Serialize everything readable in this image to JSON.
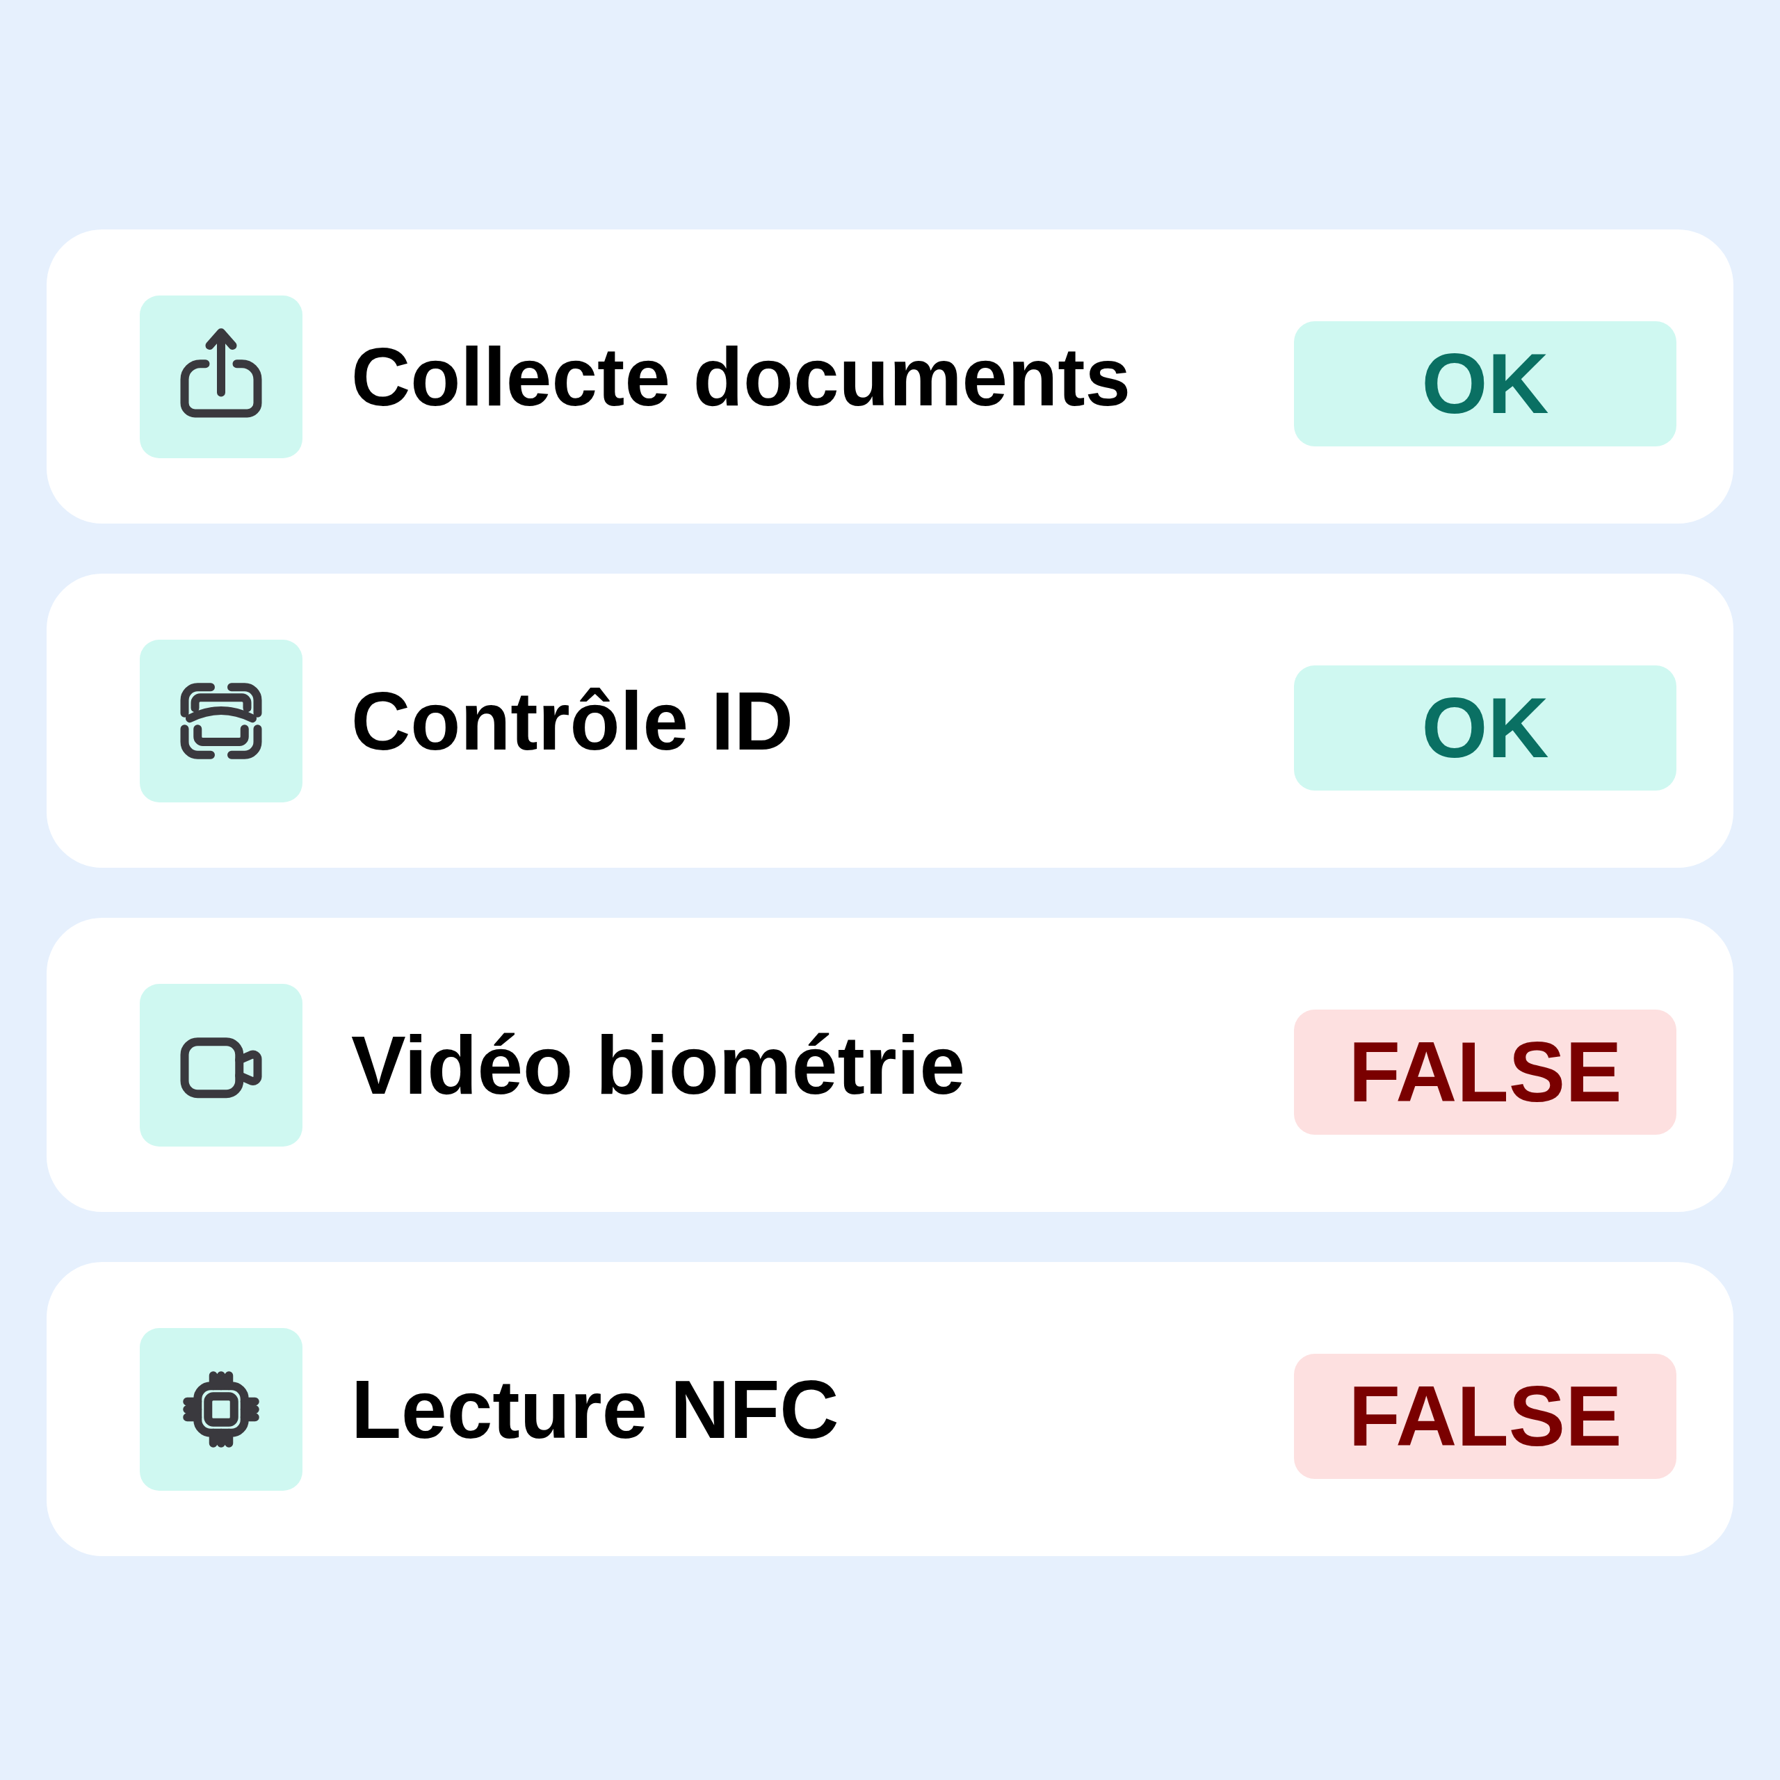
{
  "checks": [
    {
      "kind": "upload",
      "label": "Collecte documents",
      "status": {
        "kind": "ok",
        "text": "OK"
      }
    },
    {
      "kind": "scan",
      "label": "Contrôle ID",
      "status": {
        "kind": "ok",
        "text": "OK"
      }
    },
    {
      "kind": "video",
      "label": "Vidéo biométrie",
      "status": {
        "kind": "fail",
        "text": "FALSE"
      }
    },
    {
      "kind": "chip",
      "label": "Lecture NFC",
      "status": {
        "kind": "fail",
        "text": "FALSE"
      }
    }
  ]
}
